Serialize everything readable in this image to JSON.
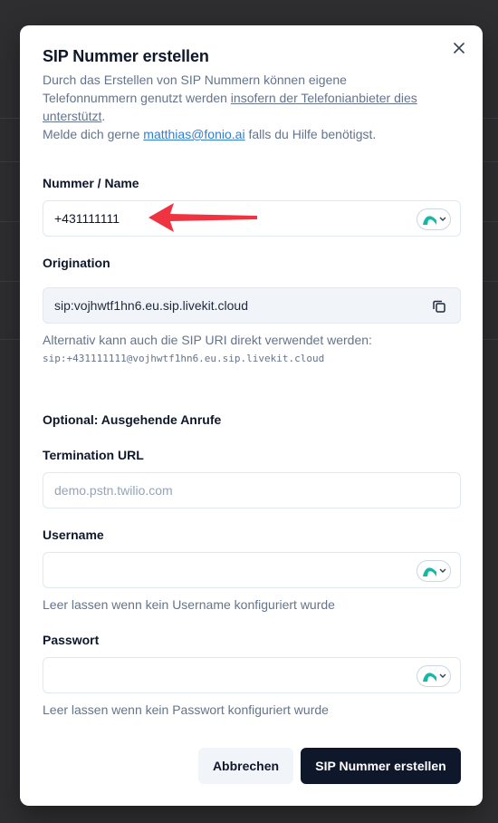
{
  "dialog": {
    "title": "SIP Nummer erstellen",
    "desc_line1": "Durch das Erstellen von SIP Nummern können eigene",
    "desc_line2_pre": "Telefonnummern genutzt werden ",
    "desc_line2_link": "insofern der Telefonianbieter dies",
    "desc_line3_link": "unterstützt",
    "desc_line3_post": ".",
    "desc_line4_pre": "Melde dich gerne ",
    "desc_email": "matthias@fonio.ai",
    "desc_line4_post": " falls du Hilfe benötigst."
  },
  "number_field": {
    "label": "Nummer / Name",
    "value": "+431111111"
  },
  "origination": {
    "label": "Origination",
    "value": "sip:vojhwtf1hn6.eu.sip.livekit.cloud",
    "hint": "Alternativ kann auch die SIP URI direkt verwendet werden:",
    "sip_uri": "sip:+431111111@vojhwtf1hn6.eu.sip.livekit.cloud"
  },
  "outbound": {
    "section_title": "Optional: Ausgehende Anrufe",
    "termination_label": "Termination URL",
    "termination_placeholder": "demo.pstn.twilio.com",
    "username_label": "Username",
    "username_hint": "Leer lassen wenn kein Username konfiguriert wurde",
    "password_label": "Passwort",
    "password_hint": "Leer lassen wenn kein Passwort konfiguriert wurde"
  },
  "actions": {
    "cancel": "Abbrechen",
    "submit": "SIP Nummer erstellen"
  },
  "colors": {
    "primary": "#0f172a",
    "link": "#2f7fd1",
    "annotation_arrow": "#ef3340",
    "pw_icon": "#14b8a6"
  },
  "icons": [
    "close-icon",
    "copy-icon",
    "password-manager-icon",
    "chevron-down-icon",
    "annotation-arrow"
  ]
}
